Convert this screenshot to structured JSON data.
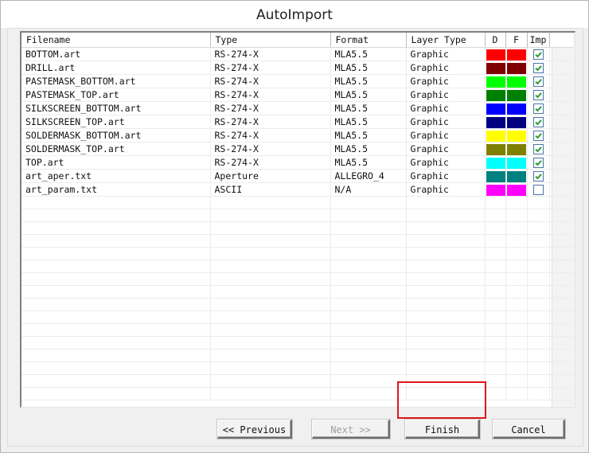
{
  "window": {
    "title": "AutoImport"
  },
  "table": {
    "columns": [
      {
        "key": "filename",
        "label": "Filename"
      },
      {
        "key": "type",
        "label": "Type"
      },
      {
        "key": "format",
        "label": "Format"
      },
      {
        "key": "layer_type",
        "label": "Layer Type"
      },
      {
        "key": "d",
        "label": "D"
      },
      {
        "key": "f",
        "label": "F"
      },
      {
        "key": "imp",
        "label": "Imp"
      }
    ],
    "rows": [
      {
        "filename": "BOTTOM.art",
        "type": "RS-274-X",
        "format": "MLA5.5",
        "layer_type": "Graphic",
        "d_color": "#ff0000",
        "f_color": "#ff0000",
        "imp": true
      },
      {
        "filename": "DRILL.art",
        "type": "RS-274-X",
        "format": "MLA5.5",
        "layer_type": "Graphic",
        "d_color": "#800000",
        "f_color": "#800000",
        "imp": true
      },
      {
        "filename": "PASTEMASK_BOTTOM.art",
        "type": "RS-274-X",
        "format": "MLA5.5",
        "layer_type": "Graphic",
        "d_color": "#00ff00",
        "f_color": "#00ff00",
        "imp": true
      },
      {
        "filename": "PASTEMASK_TOP.art",
        "type": "RS-274-X",
        "format": "MLA5.5",
        "layer_type": "Graphic",
        "d_color": "#008000",
        "f_color": "#008000",
        "imp": true
      },
      {
        "filename": "SILKSCREEN_BOTTOM.art",
        "type": "RS-274-X",
        "format": "MLA5.5",
        "layer_type": "Graphic",
        "d_color": "#0000ff",
        "f_color": "#0000ff",
        "imp": true
      },
      {
        "filename": "SILKSCREEN_TOP.art",
        "type": "RS-274-X",
        "format": "MLA5.5",
        "layer_type": "Graphic",
        "d_color": "#000080",
        "f_color": "#000080",
        "imp": true
      },
      {
        "filename": "SOLDERMASK_BOTTOM.art",
        "type": "RS-274-X",
        "format": "MLA5.5",
        "layer_type": "Graphic",
        "d_color": "#ffff00",
        "f_color": "#ffff00",
        "imp": true
      },
      {
        "filename": "SOLDERMASK_TOP.art",
        "type": "RS-274-X",
        "format": "MLA5.5",
        "layer_type": "Graphic",
        "d_color": "#808000",
        "f_color": "#808000",
        "imp": true
      },
      {
        "filename": "TOP.art",
        "type": "RS-274-X",
        "format": "MLA5.5",
        "layer_type": "Graphic",
        "d_color": "#00ffff",
        "f_color": "#00ffff",
        "imp": true
      },
      {
        "filename": "art_aper.txt",
        "type": "Aperture",
        "format": "ALLEGRO_4",
        "layer_type": "Graphic",
        "d_color": "#008080",
        "f_color": "#008080",
        "imp": true
      },
      {
        "filename": "art_param.txt",
        "type": "ASCII",
        "format": "N/A",
        "layer_type": "Graphic",
        "d_color": "#ff00ff",
        "f_color": "#ff00ff",
        "imp": false
      }
    ]
  },
  "buttons": {
    "previous": {
      "label": "<< Previous",
      "enabled": true
    },
    "next": {
      "label": "Next  >>",
      "enabled": false
    },
    "finish": {
      "label": "Finish",
      "enabled": true,
      "highlighted": true
    },
    "cancel": {
      "label": "Cancel",
      "enabled": true
    }
  },
  "colors": {
    "highlight": "#e0171d",
    "check": "#2e9e3a",
    "checkbox_border": "#4a74a8"
  }
}
